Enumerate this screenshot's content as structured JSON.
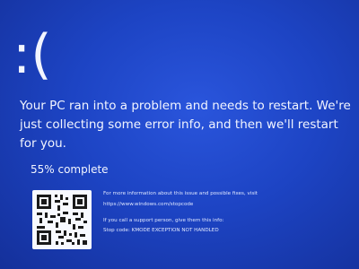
{
  "screen": {
    "emoticon": ":(",
    "message": "Your PC ran into a problem and needs to restart. We're just collecting some error info, and then we'll restart for you.",
    "progress_text": "55% complete",
    "progress_percent": 55
  },
  "info": {
    "more_info": "For more information about this issue and possible fixes, visit",
    "url": "https://www.windows.com/stopcode",
    "support": "If you call a support person, give them this info:",
    "stop_code": "Stop code: KMODE EXCEPTION NOT HANDLED"
  },
  "colors": {
    "background": "#1d44c4",
    "text": "#f2f5ff"
  },
  "icons": {
    "qr": "qr-code-icon"
  }
}
